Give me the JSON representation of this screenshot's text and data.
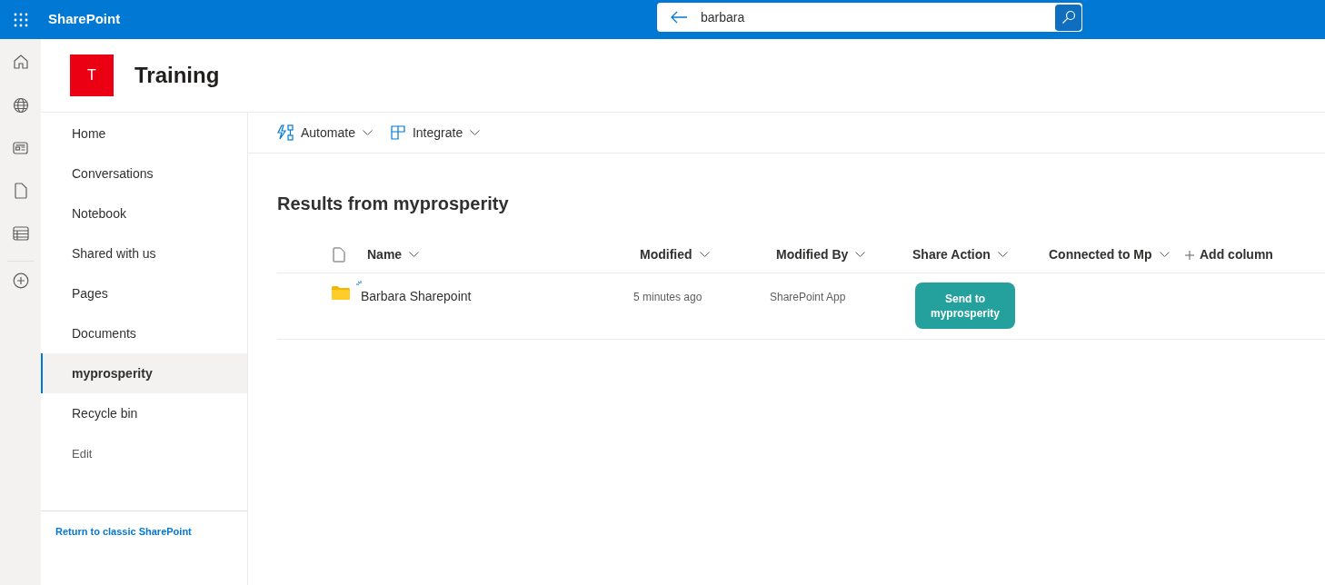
{
  "app_bar": {
    "title": "SharePoint"
  },
  "search": {
    "value": "barbara"
  },
  "site": {
    "logo_letter": "T",
    "title": "Training"
  },
  "nav": {
    "items": [
      {
        "label": "Home",
        "selected": false
      },
      {
        "label": "Conversations",
        "selected": false
      },
      {
        "label": "Notebook",
        "selected": false
      },
      {
        "label": "Shared with us",
        "selected": false
      },
      {
        "label": "Pages",
        "selected": false
      },
      {
        "label": "Documents",
        "selected": false
      },
      {
        "label": "myprosperity",
        "selected": true
      },
      {
        "label": "Recycle bin",
        "selected": false
      }
    ],
    "edit_link": "Edit",
    "footer_link": "Return to classic SharePoint"
  },
  "command_bar": [
    {
      "label": "Automate",
      "kind": "automate"
    },
    {
      "label": "Integrate",
      "kind": "integrate"
    }
  ],
  "results": {
    "heading": "Results from myprosperity"
  },
  "table": {
    "columns": [
      {
        "label": "Name"
      },
      {
        "label": "Modified"
      },
      {
        "label": "Modified By"
      },
      {
        "label": "Share Action"
      },
      {
        "label": "Connected to Mp"
      }
    ],
    "add_column": "Add column",
    "rows": [
      {
        "name": "Barbara Sharepoint",
        "new": true,
        "modified": "5 minutes ago",
        "modified_by": "SharePoint App",
        "share_action": "Send to myprosperity"
      }
    ]
  }
}
